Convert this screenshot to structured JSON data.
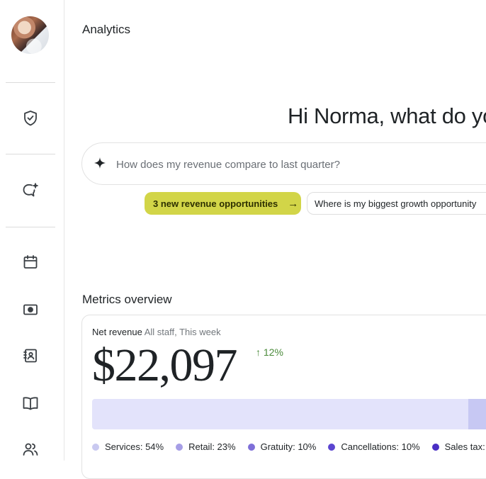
{
  "page": {
    "title": "Analytics"
  },
  "sidebar": {
    "items": [
      {
        "icon": "shield-check-icon"
      },
      {
        "icon": "ai-chat-sparkle-icon"
      },
      {
        "icon": "calendar-icon"
      },
      {
        "icon": "money-icon"
      },
      {
        "icon": "contact-book-icon"
      },
      {
        "icon": "book-icon"
      },
      {
        "icon": "people-icon"
      }
    ]
  },
  "assistant": {
    "greeting": "Hi Norma, what do yo",
    "search_placeholder": "How does my revenue compare to last quarter?",
    "suggestions": [
      {
        "label": "3 new revenue opportunities",
        "arrow": "→"
      },
      {
        "label": "Where is my biggest growth opportunity"
      }
    ]
  },
  "metrics": {
    "section_title": "Metrics overview",
    "card": {
      "label": "Net revenue",
      "sublabel": "All staff, This week",
      "value": "$22,097",
      "change_arrow": "↑",
      "change": "12%",
      "legend": [
        {
          "label": "Services: 54%",
          "color": "#c9c9f0"
        },
        {
          "label": "Retail: 23%",
          "color": "#a69ee6"
        },
        {
          "label": "Gratuity: 10%",
          "color": "#7e6fd8"
        },
        {
          "label": "Cancellations: 10%",
          "color": "#5b45d0"
        },
        {
          "label": "Sales tax:",
          "color": "#4a2fc4"
        }
      ]
    }
  },
  "colors": {
    "accent_chip": "#d2d548",
    "positive": "#4a8a3a",
    "bar_primary": "#e3e3fb",
    "bar_secondary": "#c7c8f3"
  }
}
